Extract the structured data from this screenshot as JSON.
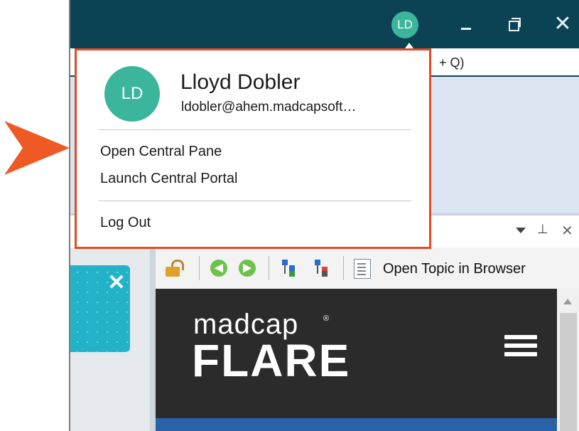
{
  "titlebar": {
    "avatar_initials": "LD",
    "minimize_icon": "minimize-icon",
    "restore_icon": "restore-icon",
    "close_glyph": "✕"
  },
  "search": {
    "shortcut_hint": "+ Q)"
  },
  "pane": {
    "pin_glyph": "⊥",
    "close_glyph": "✕"
  },
  "sidebar_card": {
    "close_glyph": "✕"
  },
  "toolbar": {
    "open_topic_label": "Open Topic in Browser",
    "icons": [
      "lock-icon",
      "back-icon",
      "forward-icon",
      "tree-icon",
      "tree-icon",
      "document-icon"
    ]
  },
  "preview": {
    "brand_small": "madcap",
    "brand_reg": "®",
    "brand_big": "FLARE"
  },
  "account_menu": {
    "initials": "LD",
    "name": "Lloyd Dobler",
    "email": "ldobler@ahem.madcapsoft…",
    "items": [
      {
        "label": "Open Central Pane"
      },
      {
        "label": "Launch Central Portal"
      }
    ],
    "logout_label": "Log Out"
  },
  "colors": {
    "titlebar": "#0b4354",
    "avatar": "#3bb69d",
    "highlight_border": "#e34b25",
    "callout_arrow": "#ef5a24",
    "teal_card": "#22b3c9"
  }
}
